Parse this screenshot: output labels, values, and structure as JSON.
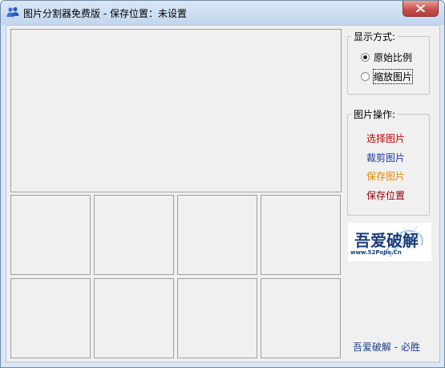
{
  "window": {
    "title": "图片分割器免费版 - 保存位置：未设置",
    "app_icon": "people-icon",
    "close_icon": "close-icon"
  },
  "display_mode": {
    "title": "显示方式:",
    "options": [
      {
        "label": "原始比例",
        "checked": true
      },
      {
        "label": "缩放图片",
        "checked": false
      }
    ]
  },
  "image_ops": {
    "title": "图片操作:",
    "actions": [
      {
        "label": "选择图片",
        "color": "#c00000"
      },
      {
        "label": "裁剪图片",
        "color": "#1a3a9c"
      },
      {
        "label": "保存图片",
        "color": "#e08a00"
      },
      {
        "label": "保存位置",
        "color": "#8b0000"
      }
    ]
  },
  "logo": {
    "main_text": "吾爱破解",
    "sub_text": "www.52PoJie.Cn"
  },
  "footer": {
    "text": "吾爱破解 - 必胜"
  }
}
